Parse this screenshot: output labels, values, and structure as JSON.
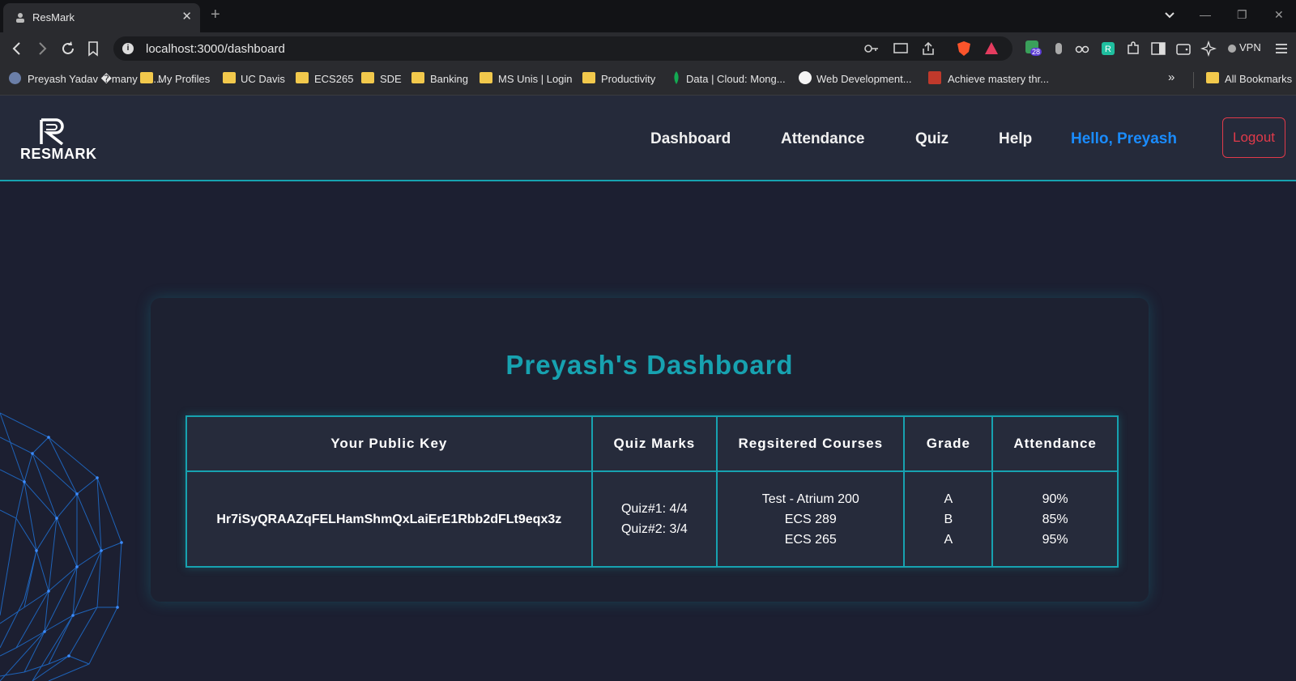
{
  "browser": {
    "tab_title": "ResMark",
    "url": "localhost:3000/dashboard",
    "vpn_label": "VPN",
    "extension_badge": "28",
    "bookmarks": [
      {
        "label": "Preyash Yadav �many Po...",
        "icon": "profile-icon"
      },
      {
        "label": "My Profiles",
        "icon": "folder-icon"
      },
      {
        "label": "UC Davis",
        "icon": "folder-icon"
      },
      {
        "label": "ECS265",
        "icon": "folder-icon"
      },
      {
        "label": "SDE",
        "icon": "folder-icon"
      },
      {
        "label": "Banking",
        "icon": "folder-icon"
      },
      {
        "label": "MS Unis | Login",
        "icon": "folder-icon"
      },
      {
        "label": "Productivity",
        "icon": "folder-icon"
      },
      {
        "label": "Data | Cloud: Mong...",
        "icon": "mongodb-leaf-icon"
      },
      {
        "label": "Web Development...",
        "icon": "site-icon"
      },
      {
        "label": "Achieve mastery thr...",
        "icon": "site-icon"
      }
    ],
    "all_bookmarks": "All Bookmarks"
  },
  "app": {
    "logo_text": "RESMARK",
    "nav": {
      "dashboard": "Dashboard",
      "attendance": "Attendance",
      "quiz": "Quiz",
      "help": "Help",
      "hello": "Hello, Preyash",
      "logout": "Logout"
    },
    "dashboard": {
      "title": "Preyash's Dashboard",
      "headers": [
        "Your Public Key",
        "Quiz Marks",
        "Regsitered Courses",
        "Grade",
        "Attendance"
      ],
      "public_key": "Hr7iSyQRAAZqFELHamShmQxLaiErE1Rbb2dFLt9eqx3z",
      "quiz_marks": [
        "Quiz#1: 4/4",
        "Quiz#2: 3/4"
      ],
      "courses": [
        "Test - Atrium 200",
        "ECS 289",
        "ECS 265"
      ],
      "grades": [
        "A",
        "B",
        "A"
      ],
      "attendance": [
        "90%",
        "85%",
        "95%"
      ]
    }
  },
  "colors": {
    "accent": "#17a2b0",
    "hello": "#1a8cff",
    "logout": "#e03a4a",
    "background": "#1c1f31"
  }
}
